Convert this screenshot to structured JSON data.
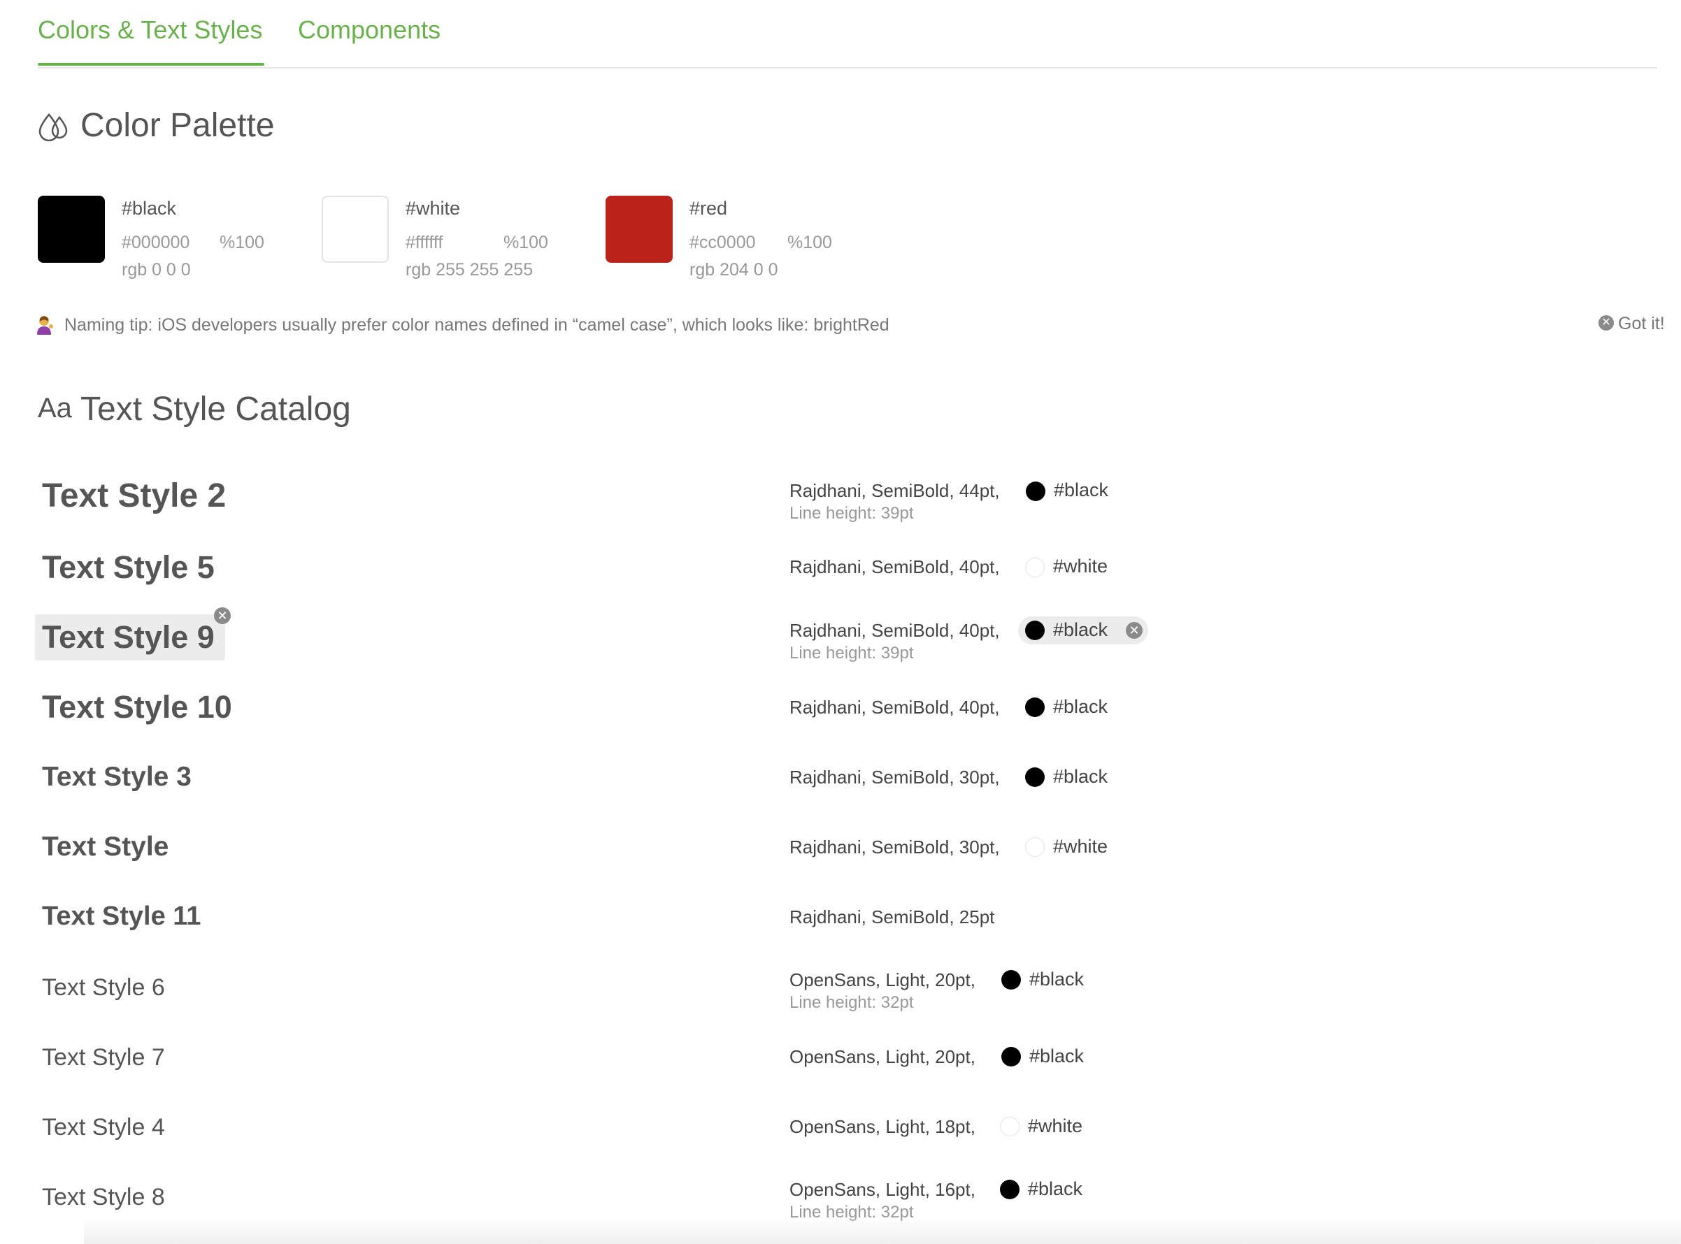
{
  "tabs": {
    "colors": "Colors & Text Styles",
    "components": "Components"
  },
  "palette": {
    "title": "Color Palette",
    "icon": "drops-icon",
    "colors": [
      {
        "name": "#black",
        "hex": "#000000",
        "opacity": "%100",
        "rgb": "rgb 0 0 0",
        "swatch": "#000000"
      },
      {
        "name": "#white",
        "hex": "#ffffff",
        "opacity": "%100",
        "rgb": "rgb 255 255 255",
        "swatch": "#ffffff"
      },
      {
        "name": "#red",
        "hex": "#cc0000",
        "opacity": "%100",
        "rgb": "rgb 204 0 0",
        "swatch": "#bb231a"
      }
    ]
  },
  "tip": {
    "text": "Naming tip: iOS developers usually prefer color names defined in “camel case”, which looks like: brightRed",
    "dismiss": "Got it!"
  },
  "catalog": {
    "icon_text": "Aa",
    "title": "Text Style Catalog",
    "styles": [
      {
        "name": "Text Style 2",
        "desc": "Rajdhani, SemiBold, 44pt,",
        "line_height": "Line height: 39pt",
        "color": "#black"
      },
      {
        "name": "Text Style 5",
        "desc": "Rajdhani, SemiBold, 40pt,",
        "line_height": "",
        "color": "#white"
      },
      {
        "name": "Text Style 9",
        "desc": "Rajdhani, SemiBold, 40pt,",
        "line_height": "Line height: 39pt",
        "color": "#black"
      },
      {
        "name": "Text Style 10",
        "desc": "Rajdhani, SemiBold, 40pt,",
        "line_height": "",
        "color": "#black"
      },
      {
        "name": "Text Style 3",
        "desc": "Rajdhani, SemiBold, 30pt,",
        "line_height": "",
        "color": "#black"
      },
      {
        "name": "Text Style",
        "desc": "Rajdhani, SemiBold, 30pt,",
        "line_height": "",
        "color": "#white"
      },
      {
        "name": "Text Style 11",
        "desc": "Rajdhani, SemiBold, 25pt",
        "line_height": "",
        "color": ""
      },
      {
        "name": "Text Style 6",
        "desc": "OpenSans, Light, 20pt,",
        "line_height": "Line height: 32pt",
        "color": "#black"
      },
      {
        "name": "Text Style 7",
        "desc": "OpenSans, Light, 20pt,",
        "line_height": "",
        "color": "#black"
      },
      {
        "name": "Text Style 4",
        "desc": "OpenSans, Light, 18pt,",
        "line_height": "",
        "color": "#white"
      },
      {
        "name": "Text Style 8",
        "desc": "OpenSans, Light, 16pt,",
        "line_height": "Line height: 32pt",
        "color": "#black"
      }
    ]
  }
}
